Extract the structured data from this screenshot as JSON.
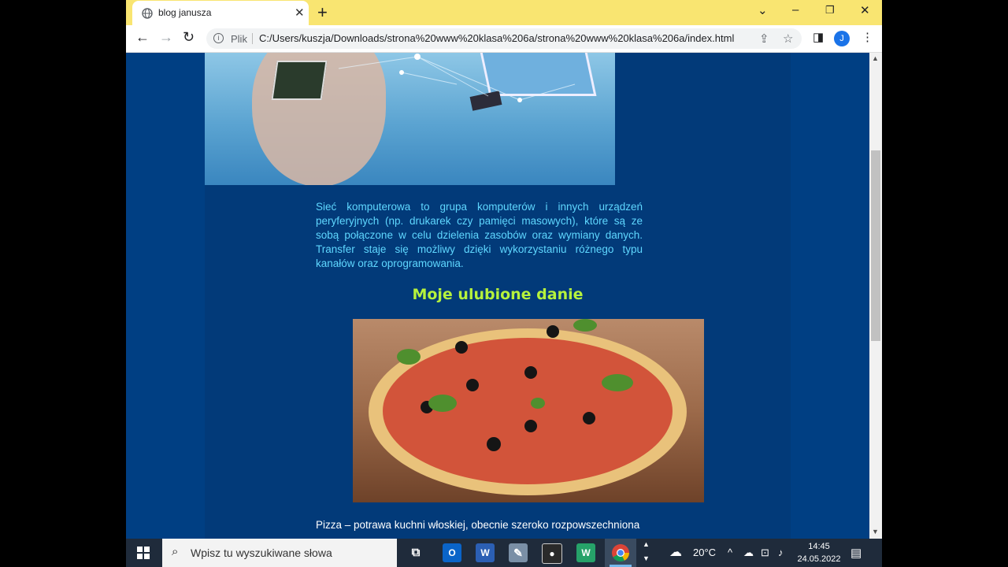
{
  "browser": {
    "tab_title": "blog janusza",
    "new_tab": "+",
    "scheme_label": "Plik",
    "url": "C:/Users/kuszja/Downloads/strona%20www%20klasa%206a/strona%20www%20klasa%206a/index.html",
    "profile_initial": "J",
    "accent": "#f9e571"
  },
  "page": {
    "paragraph1": "Sieć komputerowa to grupa komputerów i innych urządzeń peryferyjnych (np. drukarek czy pamięci masowych), które są ze sobą połączone w celu dzielenia zasobów oraz wymiany danych. Transfer staje się możliwy dzięki wykorzystaniu różnego typu kanałów oraz oprogramowania.",
    "heading": "Moje ulubione danie",
    "paragraph2": "Pizza – potrawa kuchni włoskiej, obecnie szeroko rozpowszechniona",
    "background": "#003f83",
    "heading_color": "#b6f23c",
    "text_color": "#5fd7ff"
  },
  "taskbar": {
    "search_placeholder": "Wpisz tu wyszukiwane słowa",
    "temperature": "20°C",
    "time": "14:45",
    "date": "24.05.2022"
  }
}
